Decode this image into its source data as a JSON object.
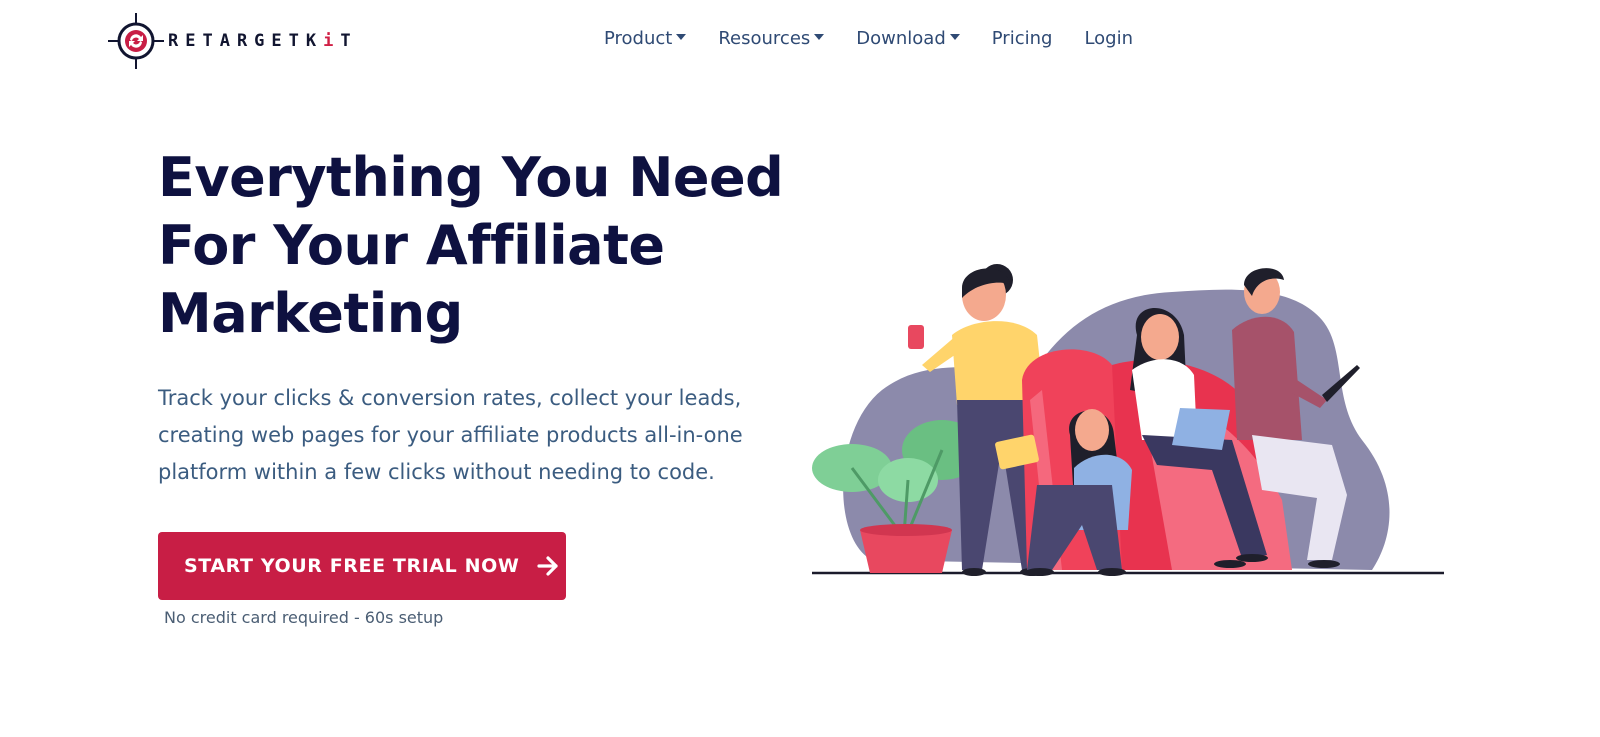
{
  "brand": {
    "name_main": "RETARGETK",
    "name_accent": "i",
    "name_tail": "T",
    "primary_color": "#c81e45",
    "dark_color": "#0e1140"
  },
  "nav": {
    "items": [
      {
        "label": "Product",
        "dropdown": true
      },
      {
        "label": "Resources",
        "dropdown": true
      },
      {
        "label": "Download",
        "dropdown": true
      },
      {
        "label": "Pricing",
        "dropdown": false
      },
      {
        "label": "Login",
        "dropdown": false
      }
    ]
  },
  "hero": {
    "title": [
      "Everything You Need",
      "For Your Affiliate",
      "Marketing"
    ],
    "subtitle": [
      "Track your clicks & conversion rates, collect your leads,",
      "creating web pages for your affiliate products all-in-one",
      "platform within a few clicks without needing to code."
    ],
    "cta_label": "START YOUR FREE TRIAL NOW",
    "cta_icon": "arrow-right-icon",
    "cta_note": "No credit card required - 60s setup"
  }
}
